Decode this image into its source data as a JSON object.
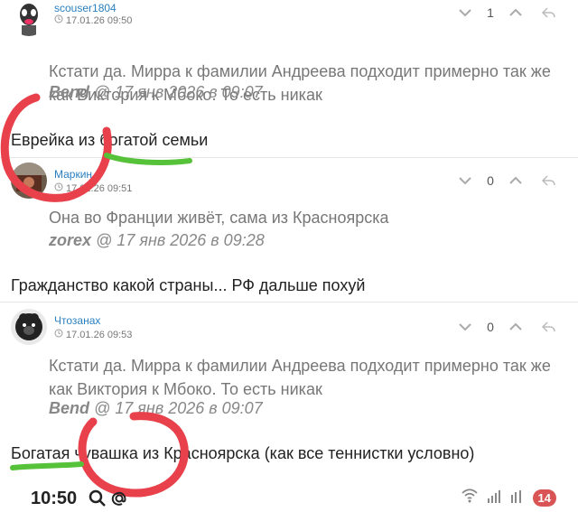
{
  "comments": [
    {
      "username": "scouser1804",
      "timestamp": "17.01.26 09:50",
      "votes": "1",
      "quote": "Кстати да. Мирра к фамилии Андреева подходит примерно так же как Виктория к Мбоко. То есть никак",
      "quote_author": "Bend",
      "quote_date": " @ 17 янв 2026 в 09:07",
      "text": "Еврейка из богатой семьи"
    },
    {
      "username": "Маркин",
      "timestamp": "17.01.26 09:51",
      "votes": "0",
      "quote": "Она во Франции живёт, сама из Красноярска",
      "quote_author": "zorex",
      "quote_date": " @ 17 янв 2026 в 09:28",
      "text": "Гражданство какой страны... РФ дальше похуй"
    },
    {
      "username": "Чтозанах",
      "timestamp": "17.01.26 09:53",
      "votes": "0",
      "quote": "Кстати да. Мирра к фамилии Андреева подходит примерно так же как Виктория к Мбоко. То есть никак",
      "quote_author": "Bend",
      "quote_date": " @ 17 янв 2026 в 09:07",
      "text": "Богатая чувашка из Красноярска (как все теннистки условно)"
    }
  ],
  "statusbar": {
    "time": "10:50",
    "battery": "14"
  },
  "icons": {
    "clock": "clock-icon",
    "downvote": "chevron-down-icon",
    "upvote": "chevron-up-icon",
    "reply": "reply-icon",
    "search": "search-icon",
    "at": "at-icon"
  },
  "colors": {
    "username": "#2a7fbf",
    "marker_red": "#e8414b",
    "marker_green": "#55c23a",
    "badge": "#d95555"
  }
}
